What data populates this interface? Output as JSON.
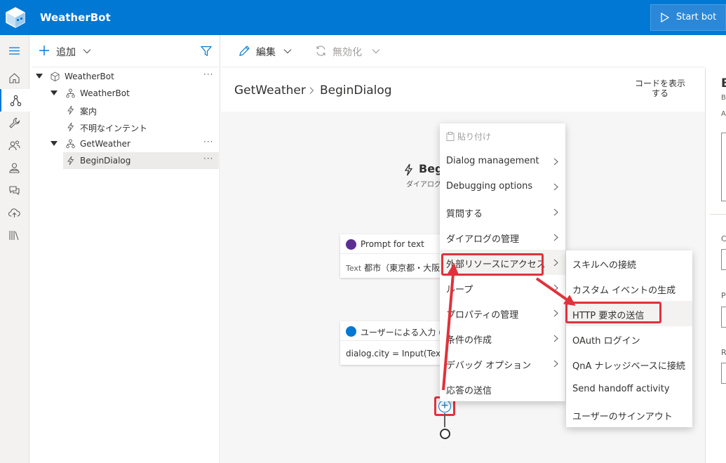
{
  "header": {
    "app_title": "WeatherBot",
    "start_bot_label": "Start bot",
    "brand_color": "#0078d4"
  },
  "rail": {
    "icons": [
      "hamburger-icon",
      "home-icon",
      "bot-design-icon",
      "wrench-icon",
      "users-icon",
      "bot-icon",
      "chat-icon",
      "cloud-upload-icon",
      "library-icon"
    ],
    "active_index": 2
  },
  "tree": {
    "add_label": "追加",
    "items": [
      {
        "label": "WeatherBot",
        "icon": "cube-icon",
        "level": 0,
        "expanded": true,
        "more": "···"
      },
      {
        "label": "WeatherBot",
        "icon": "dialog-tree-icon",
        "level": 1,
        "expanded": true,
        "more": ""
      },
      {
        "label": "案内",
        "icon": "lightning-icon",
        "level": 2,
        "more": ""
      },
      {
        "label": "不明なインテント",
        "icon": "lightning-icon",
        "level": 2,
        "more": ""
      },
      {
        "label": "GetWeather",
        "icon": "dialog-tree-icon",
        "level": 1,
        "expanded": true,
        "more": "···"
      },
      {
        "label": "BeginDialog",
        "icon": "lightning-icon",
        "level": 2,
        "selected": true,
        "more": "···"
      }
    ]
  },
  "toolbar": {
    "edit_label": "編集",
    "disable_label": "無効化"
  },
  "breadcrumb": {
    "dialog": "GetWeather",
    "trigger": "BeginDialog"
  },
  "show_code_label": "コードを表示する",
  "canvas": {
    "trigger_title": "Beg",
    "trigger_subtitle": "ダイアログの",
    "nodes": [
      {
        "header": "Prompt for text",
        "body_key": "Text",
        "body_value": "都市（東京都・大阪",
        "badge_color": "#5c2e91"
      },
      {
        "header": "ユーザーによる入力 (Text",
        "body_key": "",
        "body_value": "dialog.city = Input(Text)",
        "badge_color": "#0078d4"
      }
    ],
    "add_symbol": "+"
  },
  "right_panel": {
    "title_letter": "B",
    "small_b": "B",
    "small_a": "A",
    "labels": [
      "C",
      "P",
      "R"
    ]
  },
  "context_menu": {
    "paste_label": "貼り付け",
    "items": [
      "Dialog management",
      "Debugging options",
      "質問する",
      "ダイアログの管理",
      "外部リソースにアクセス",
      "ループ",
      "プロパティの管理",
      "条件の作成",
      "デバッグ オプション",
      "応答の送信"
    ],
    "highlighted_index": 4
  },
  "submenu": {
    "items": [
      "スキルへの接続",
      "カスタム イベントの生成",
      "HTTP 要求の送信",
      "OAuth ログイン",
      "QnA ナレッジベースに接続",
      "Send handoff activity",
      "ユーザーのサインアウト"
    ],
    "highlighted_index": 2
  },
  "annotation_color": "#e0323b"
}
